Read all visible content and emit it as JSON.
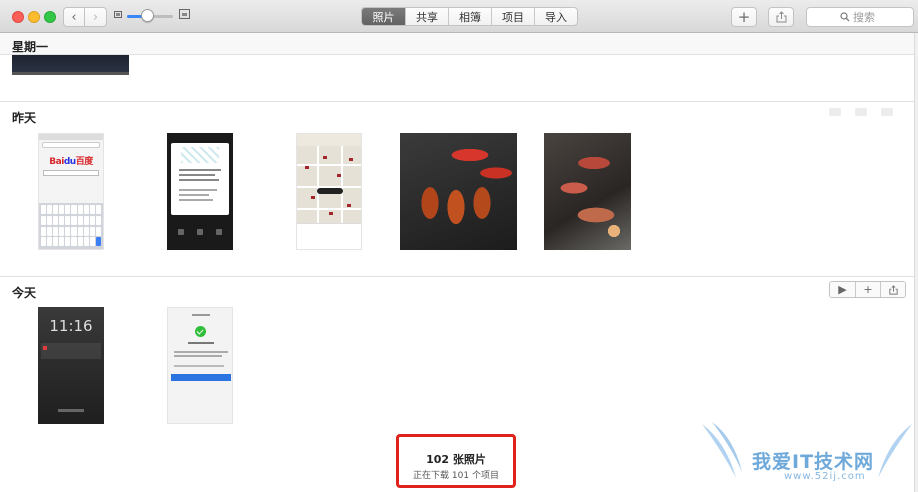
{
  "toolbar": {
    "tabs": [
      {
        "label": "照片",
        "active": true
      },
      {
        "label": "共享",
        "active": false
      },
      {
        "label": "相簿",
        "active": false
      },
      {
        "label": "项目",
        "active": false
      },
      {
        "label": "导入",
        "active": false
      }
    ],
    "add_label": "+",
    "search_placeholder": "搜索",
    "zoom_level": 0.45
  },
  "sections": {
    "monday": {
      "title": "星期一"
    },
    "yesterday": {
      "title": "昨天"
    },
    "today": {
      "title": "今天"
    }
  },
  "photos": {
    "baidu": {
      "logo_a": "Bai",
      "logo_b": "du",
      "logo_c": "百度"
    },
    "lockscreen": {
      "time": "11:16"
    }
  },
  "status": {
    "count": "102 张照片",
    "progress": "正在下载 101 个项目"
  },
  "watermark": {
    "text": "我爱IT技术网",
    "url": "www.52ij.com"
  },
  "colors": {
    "accent": "#3b86f7",
    "highlight_box": "#e0221c"
  }
}
